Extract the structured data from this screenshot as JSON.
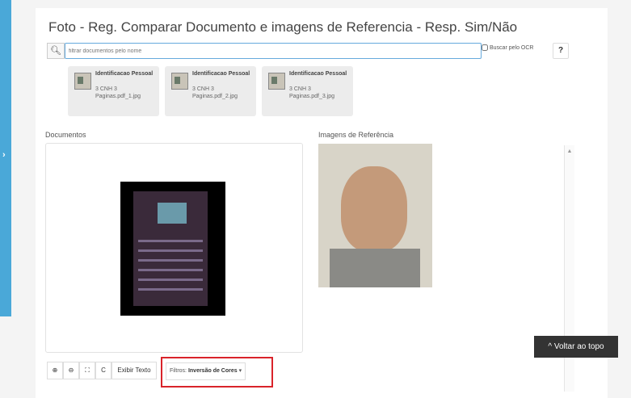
{
  "sidebar": {
    "toggle_icon": "chevron-right-icon",
    "toggle_glyph": "›"
  },
  "page": {
    "title": "Foto - Reg. Comparar Documento e imagens de Referencia - Resp. Sim/Não"
  },
  "search": {
    "placeholder": "filtrar documentos pelo nome",
    "ocr_label": "Buscar pelo OCR",
    "help_glyph": "?"
  },
  "thumbnails": [
    {
      "label": "Identificacao Pessoal",
      "sub": "3 CNH 3 Paginas.pdf_1.jpg"
    },
    {
      "label": "Identificacao Pessoal",
      "sub": "3 CNH 3 Paginas.pdf_2.jpg"
    },
    {
      "label": "Identificacao Pessoal",
      "sub": "3 CNH 3 Paginas.pdf_3.jpg"
    }
  ],
  "sections": {
    "documents_label": "Documentos",
    "reference_label": "Imagens de Referência"
  },
  "toolbar": {
    "zoom_in": "⊕",
    "zoom_out": "⊖",
    "fit": "⛶",
    "rotate": "C",
    "show_text": "Exibir Texto",
    "filter_prefix": "Filtros:",
    "filter_value": "Inversão de Cores",
    "filter_caret": "▾"
  },
  "back_to_top": "^ Voltar ao topo",
  "colors": {
    "accent": "#4aa8d8",
    "highlight": "#d9232a"
  }
}
